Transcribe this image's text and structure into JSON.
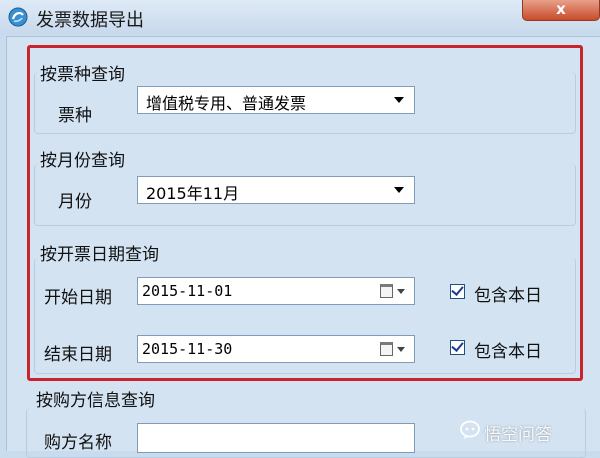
{
  "window": {
    "title": "发票数据导出",
    "close_label": "x"
  },
  "invoice_type_group": {
    "title": "按票种查询",
    "label": "票种",
    "selected": "增值税专用、普通发票"
  },
  "month_group": {
    "title": "按月份查询",
    "label": "月份",
    "selected": "2015年11月"
  },
  "date_group": {
    "title": "按开票日期查询",
    "start_label": "开始日期",
    "start_value": "2015-11-01",
    "start_include_label": "包含本日",
    "start_include_checked": true,
    "end_label": "结束日期",
    "end_value": "2015-11-30",
    "end_include_label": "包含本日",
    "end_include_checked": true
  },
  "buyer_group": {
    "title": "按购方信息查询",
    "name_label": "购方名称",
    "name_value": ""
  },
  "watermark": {
    "text": "悟空问答"
  },
  "colors": {
    "highlight_frame": "#c8242c",
    "window_bg": "#d4e3f2"
  }
}
